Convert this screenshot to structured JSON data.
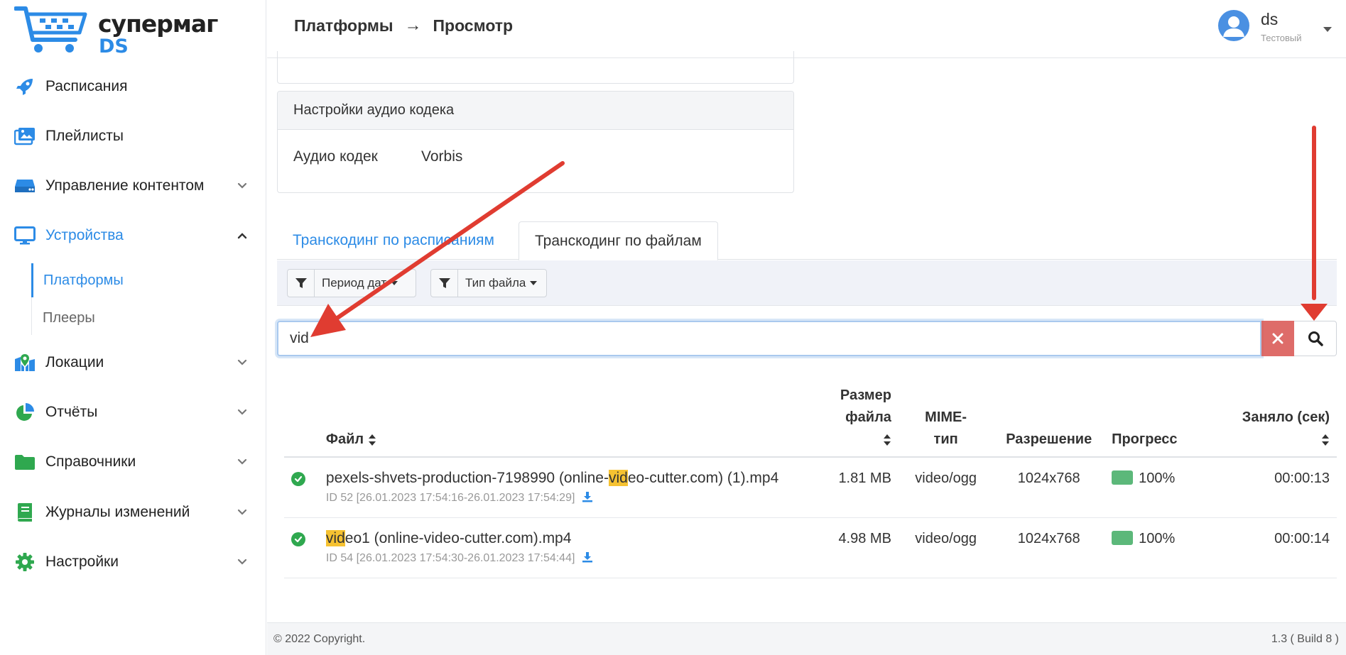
{
  "brand": {
    "line1": "супермаг",
    "line2": "DS"
  },
  "sidebar": {
    "items": [
      {
        "label": "Расписания",
        "icon": "rocket-icon"
      },
      {
        "label": "Плейлисты",
        "icon": "images-icon"
      },
      {
        "label": "Управление контентом",
        "icon": "hdd-icon"
      },
      {
        "label": "Устройства",
        "icon": "desktop-icon"
      },
      {
        "label": "Локации",
        "icon": "map-icon"
      },
      {
        "label": "Отчёты",
        "icon": "pie-chart-icon"
      },
      {
        "label": "Справочники",
        "icon": "folder-icon"
      },
      {
        "label": "Журналы изменений",
        "icon": "book-icon"
      },
      {
        "label": "Настройки",
        "icon": "gear-icon"
      }
    ],
    "sub": [
      {
        "label": "Платформы"
      },
      {
        "label": "Плееры"
      }
    ]
  },
  "header": {
    "breadcrumb": {
      "parent": "Платформы",
      "sep": "→",
      "current": "Просмотр"
    },
    "user": {
      "name": "ds",
      "role": "Тестовый"
    }
  },
  "audio_card": {
    "title": "Настройки аудио кодека",
    "key": "Аудио кодек",
    "value": "Vorbis"
  },
  "tabs": [
    "Транскодинг по расписаниям",
    "Транскодинг по файлам"
  ],
  "filters": [
    "Период дат",
    "Тип файла"
  ],
  "search": {
    "value": "vid"
  },
  "table": {
    "headers": {
      "file": "Файл",
      "size_line1": "Размер файла",
      "mime_line1": "MIME-",
      "mime_line2": "тип",
      "resolution": "Разрешение",
      "progress": "Прогресс",
      "time": "Заняло (сек)"
    },
    "rows": [
      {
        "name_pre": "pexels-shvets-production-7198990 (online-",
        "name_hl": "vid",
        "name_post": "eo-cutter.com) (1).mp4",
        "meta": "ID 52 [26.01.2023 17:54:16-26.01.2023 17:54:29]",
        "size": "1.81 MB",
        "mime": "video/ogg",
        "resolution": "1024x768",
        "progress": "100%",
        "time": "00:00:13"
      },
      {
        "name_pre": "",
        "name_hl": "vid",
        "name_post": "eo1 (online-video-cutter.com).mp4",
        "meta": "ID 54 [26.01.2023 17:54:30-26.01.2023 17:54:44]",
        "size": "4.98 MB",
        "mime": "video/ogg",
        "resolution": "1024x768",
        "progress": "100%",
        "time": "00:00:14"
      }
    ]
  },
  "footer": {
    "copyright": "© 2022 Copyright.",
    "version": "1.3 ( Build 8 )"
  },
  "colors": {
    "accent": "#2c8be6",
    "success": "#2fa84f",
    "highlight": "#f6c231",
    "arrow": "#e03c31",
    "danger": "#d9534f"
  }
}
